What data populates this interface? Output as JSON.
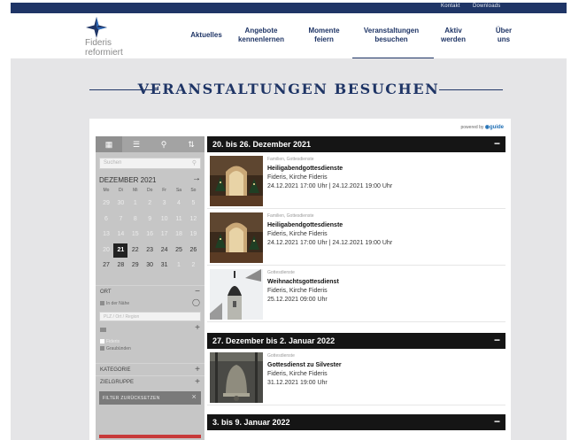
{
  "topbar": {
    "links": [
      "Kontakt",
      "Downloads"
    ]
  },
  "logo": {
    "line1": "Fideris",
    "line2": "reformiert"
  },
  "nav": [
    {
      "line1": "Aktuelles",
      "line2": ""
    },
    {
      "line1": "Angebote",
      "line2": "kennenlernen"
    },
    {
      "line1": "Momente",
      "line2": "feiern"
    },
    {
      "line1": "Veranstaltungen",
      "line2": "besuchen",
      "active": true
    },
    {
      "line1": "Aktiv",
      "line2": "werden"
    },
    {
      "line1": "Über",
      "line2": "uns"
    }
  ],
  "page_title": "VERANSTALTUNGEN BESUCHEN",
  "powered_by": {
    "prefix": "powered by",
    "brand": "guide"
  },
  "sidebar": {
    "tab_icons": [
      "grid-icon",
      "list-icon",
      "map-pin-icon",
      "sort-icon"
    ],
    "search_placeholder": "Suchen",
    "month": "DEZEMBER 2021",
    "next_icon": "→",
    "weekdays": [
      "Mo",
      "Di",
      "Mi",
      "Do",
      "Fr",
      "Sa",
      "So"
    ],
    "weeks": [
      [
        [
          "29",
          true
        ],
        [
          "30",
          true
        ],
        [
          "1",
          true
        ],
        [
          "2",
          true
        ],
        [
          "3",
          true
        ],
        [
          "4",
          true
        ],
        [
          "5",
          true
        ]
      ],
      [
        [
          "6",
          true
        ],
        [
          "7",
          true
        ],
        [
          "8",
          true
        ],
        [
          "9",
          true
        ],
        [
          "10",
          true
        ],
        [
          "11",
          true
        ],
        [
          "12",
          true
        ]
      ],
      [
        [
          "13",
          true
        ],
        [
          "14",
          true
        ],
        [
          "15",
          true
        ],
        [
          "16",
          true
        ],
        [
          "17",
          true
        ],
        [
          "18",
          true
        ],
        [
          "19",
          true
        ]
      ],
      [
        [
          "20",
          true
        ],
        [
          "21",
          false
        ],
        [
          "22",
          false
        ],
        [
          "23",
          false
        ],
        [
          "24",
          false
        ],
        [
          "25",
          false
        ],
        [
          "26",
          false
        ]
      ],
      [
        [
          "27",
          false
        ],
        [
          "28",
          false
        ],
        [
          "29",
          false
        ],
        [
          "30",
          false
        ],
        [
          "31",
          false
        ],
        [
          "1",
          true
        ],
        [
          "2",
          true
        ]
      ]
    ],
    "selected_day": "21",
    "ort_label": "ORT",
    "nearby_label": "In der Nähe",
    "plz_placeholder": "PLZ / Ort / Region",
    "region_1": "Fideris",
    "region_2": "Graubünden",
    "kategorie_label": "KATEGORIE",
    "zielgruppe_label": "ZIELGRUPPE",
    "reset_label": "FILTER ZURÜCKSETZEN"
  },
  "weeks": [
    {
      "header": "20. bis 26. Dezember 2021",
      "events": [
        {
          "category": "Familien, Gottesdienste",
          "title": "Heiligabendgottesdienste",
          "place": "Fideris, Kirche Fideris",
          "date": "24.12.2021 17:00 Uhr | 24.12.2021 19:00 Uhr",
          "image": "church-interior-image"
        },
        {
          "category": "Familien, Gottesdienste",
          "title": "Heiligabendgottesdienste",
          "place": "Fideris, Kirche Fideris",
          "date": "24.12.2021 17:00 Uhr | 24.12.2021 19:00 Uhr",
          "image": "church-interior-image"
        },
        {
          "category": "Gottesdienste",
          "title": "Weihnachtsgottesdienst",
          "place": "Fideris, Kirche Fideris",
          "date": "25.12.2021 09:00 Uhr",
          "image": "church-tower-image"
        }
      ]
    },
    {
      "header": "27. Dezember bis 2. Januar 2022",
      "events": [
        {
          "category": "Gottesdienste",
          "title": "Gottesdienst zu Silvester",
          "place": "Fideris, Kirche Fideris",
          "date": "31.12.2021 19:00 Uhr",
          "image": "church-bell-image"
        }
      ]
    },
    {
      "header": "3. bis 9. Januar 2022",
      "events": []
    }
  ],
  "colors": {
    "brand": "#1f3566",
    "panel_bg": "#e5e5e7",
    "sidebar_bg": "#c6c6c6",
    "week_header_bg": "#151515",
    "reset_strip": "#c73a3a"
  }
}
